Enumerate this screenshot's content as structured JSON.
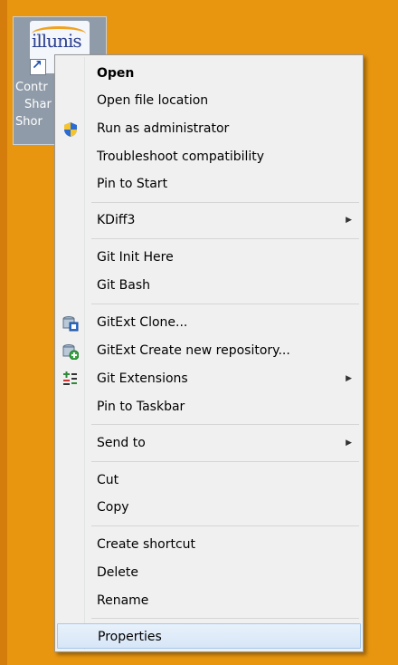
{
  "desktop_icon": {
    "logo_text": "illunis",
    "label_lines": [
      "Contr",
      "Shar",
      "Shor"
    ]
  },
  "menu": {
    "items": [
      {
        "label": "Open",
        "bold": true
      },
      {
        "label": "Open file location"
      },
      {
        "label": "Run as administrator",
        "icon": "uac-shield-icon"
      },
      {
        "label": "Troubleshoot compatibility"
      },
      {
        "label": "Pin to Start"
      },
      {
        "label": "KDiff3",
        "submenu": true
      },
      {
        "label": "Git Init Here"
      },
      {
        "label": "Git Bash"
      },
      {
        "label": "GitExt Clone...",
        "icon": "gitext-clone-icon"
      },
      {
        "label": "GitExt Create new repository...",
        "icon": "gitext-new-repo-icon"
      },
      {
        "label": "Git Extensions",
        "submenu": true,
        "icon": "git-extensions-icon"
      },
      {
        "label": "Pin to Taskbar"
      },
      {
        "label": "Send to",
        "submenu": true
      },
      {
        "label": "Cut"
      },
      {
        "label": "Copy"
      },
      {
        "label": "Create shortcut"
      },
      {
        "label": "Delete"
      },
      {
        "label": "Rename"
      },
      {
        "label": "Properties",
        "highlighted": true
      }
    ],
    "submenu_arrow": "▶"
  }
}
